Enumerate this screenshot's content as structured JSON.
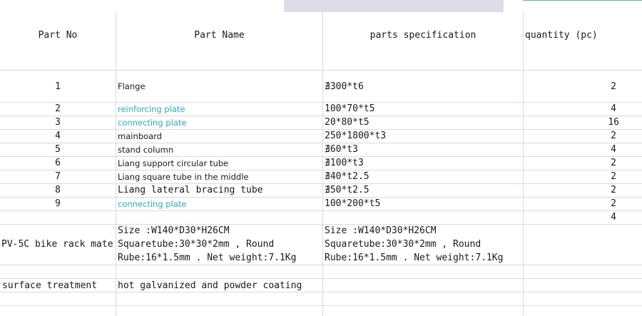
{
  "colors": {
    "grid": "#dadada",
    "link_teal": "#2bb4c4",
    "header_shade": "#dcdde8"
  },
  "headers": {
    "part_no": "Part No",
    "part_name": "Part Name",
    "spec": "parts specification",
    "qty": "quantity (pc)"
  },
  "rows": [
    {
      "no": "1",
      "name": "Flange",
      "spec": "∄300*t6",
      "qty": "2"
    },
    {
      "no": "2",
      "name": "reinforcing plate",
      "spec": "100*70*t5",
      "qty": "4"
    },
    {
      "no": "3",
      "name": "connecting plate",
      "spec": "20*80*t5",
      "qty": "16"
    },
    {
      "no": "4",
      "name": "mainboard",
      "spec": "250*1800*t3",
      "qty": "2"
    },
    {
      "no": "5",
      "name": "stand column",
      "spec": "∄60*t3",
      "qty": "4"
    },
    {
      "no": "6",
      "name": "Liang support circular tube",
      "spec": "∄100*t3",
      "qty": "2"
    },
    {
      "no": "7",
      "name": "Liang square tube in the middle",
      "spec": "∄40*t2.5",
      "qty": "2"
    },
    {
      "no": "8",
      "name": "Liang lateral bracing tube",
      "spec": "∄50*t2.5",
      "qty": "2"
    },
    {
      "no": "9",
      "name": "connecting plate",
      "spec": "100*200*t5",
      "qty": "2"
    },
    {
      "no": "",
      "name": "",
      "spec": "",
      "qty": "4"
    }
  ],
  "product": {
    "label": "PV-5C bike rack mate",
    "size_line1": "Size :W140*D30*H26CM",
    "size_line2": "Squaretube:30*30*2mm , Round",
    "size_line3": "Rube:16*1.5mm .  Net weight:7.1Kg"
  },
  "surface": {
    "label": "surface treatment",
    "value": "hot galvanized and powder coating"
  }
}
